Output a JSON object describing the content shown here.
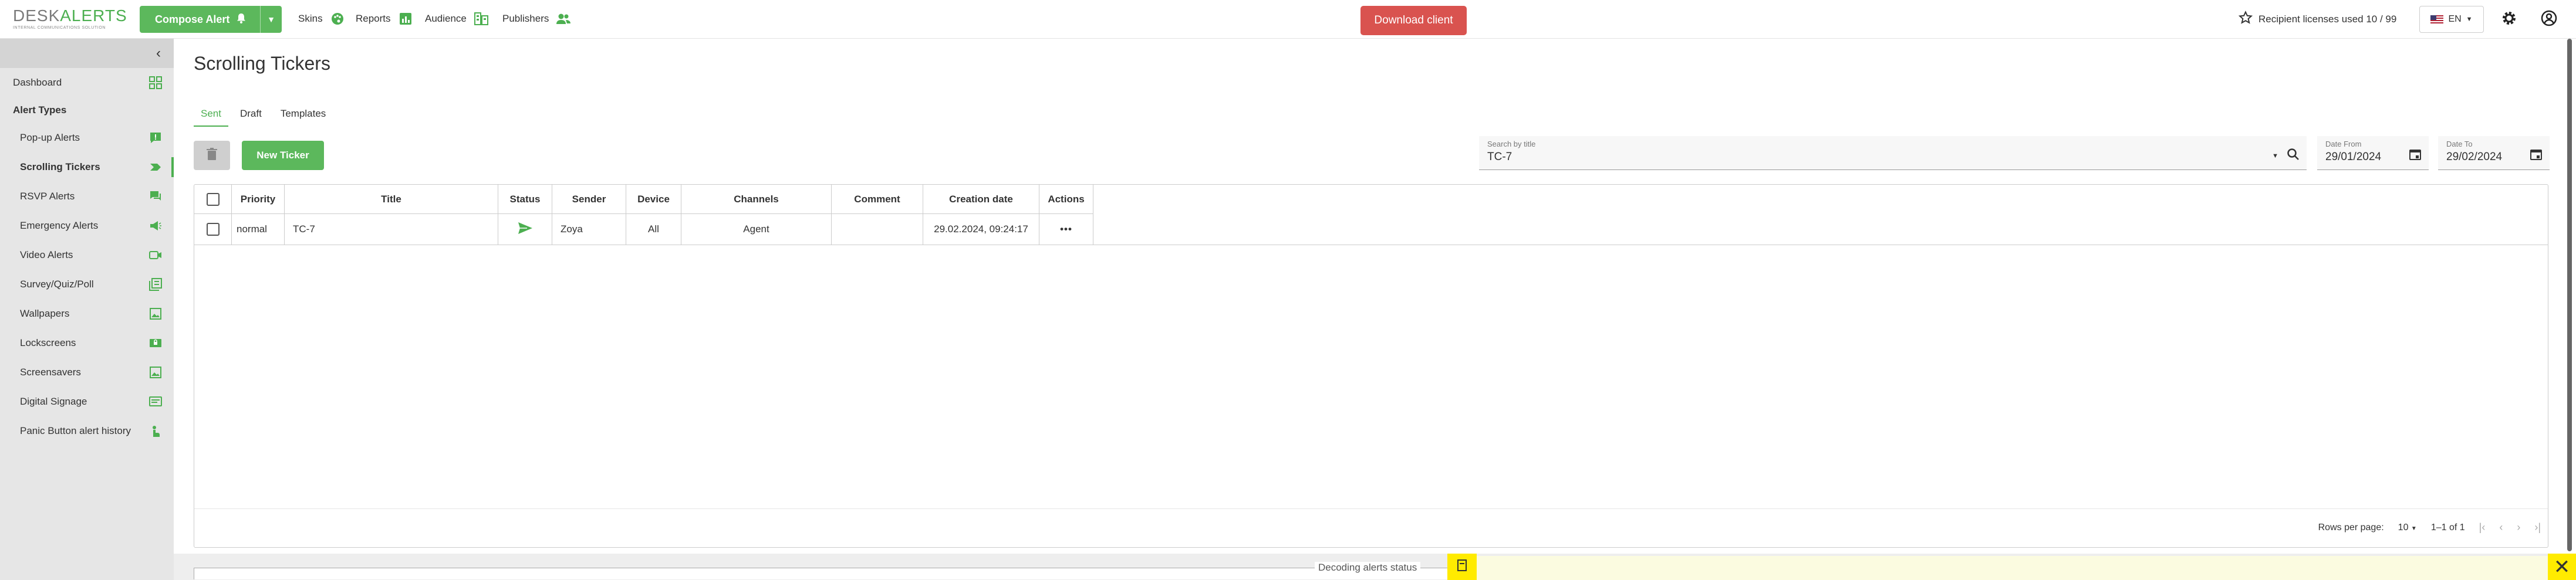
{
  "logo": {
    "text_a": "DESK",
    "text_b": "ALERTS",
    "tagline": "INTERNAL COMMUNICATIONS SOLUTION"
  },
  "header": {
    "compose_label": "Compose Alert",
    "nav": [
      "Skins",
      "Reports",
      "Audience",
      "Publishers"
    ],
    "download_label": "Download client",
    "licenses_label": "Recipient licenses used 10 / 99",
    "language": "EN"
  },
  "sidebar": {
    "dashboard": "Dashboard",
    "section_label": "Alert Types",
    "items": [
      {
        "label": "Pop-up Alerts",
        "icon": "popup-alert-icon"
      },
      {
        "label": "Scrolling Tickers",
        "icon": "ticker-icon",
        "active": true
      },
      {
        "label": "RSVP Alerts",
        "icon": "rsvp-icon"
      },
      {
        "label": "Emergency Alerts",
        "icon": "megaphone-icon"
      },
      {
        "label": "Video Alerts",
        "icon": "video-icon"
      },
      {
        "label": "Survey/Quiz/Poll",
        "icon": "survey-icon"
      },
      {
        "label": "Wallpapers",
        "icon": "wallpaper-icon"
      },
      {
        "label": "Lockscreens",
        "icon": "lockscreen-icon"
      },
      {
        "label": "Screensavers",
        "icon": "screensaver-icon"
      },
      {
        "label": "Digital Signage",
        "icon": "signage-icon"
      },
      {
        "label": "Panic Button alert history",
        "icon": "panic-button-icon"
      }
    ]
  },
  "page": {
    "title": "Scrolling Tickers",
    "tabs": [
      "Sent",
      "Draft",
      "Templates"
    ],
    "active_tab": "Sent",
    "new_button": "New Ticker"
  },
  "filters": {
    "search_label": "Search by title",
    "search_value": "TC-7",
    "date_from_label": "Date From",
    "date_from_value": "29/01/2024",
    "date_to_label": "Date To",
    "date_to_value": "29/02/2024"
  },
  "table": {
    "columns": [
      "Priority",
      "Title",
      "Status",
      "Sender",
      "Device",
      "Channels",
      "Comment",
      "Creation date",
      "Actions"
    ],
    "rows": [
      {
        "priority": "normal",
        "title": "TC-7",
        "status": "sent",
        "sender": "Zoya",
        "device": "All",
        "channels": "Agent",
        "comment": "",
        "creation_date": "29.02.2024, 09:24:17",
        "actions": "•••"
      }
    ]
  },
  "pagination": {
    "rows_per_page_label": "Rows per page:",
    "rows_per_page": "10",
    "range": "1–1 of 1"
  },
  "status_bar": {
    "label": "Decoding alerts status"
  },
  "colors": {
    "accent": "#5cb85c",
    "danger": "#d9534f",
    "highlight": "#ffeb00"
  }
}
